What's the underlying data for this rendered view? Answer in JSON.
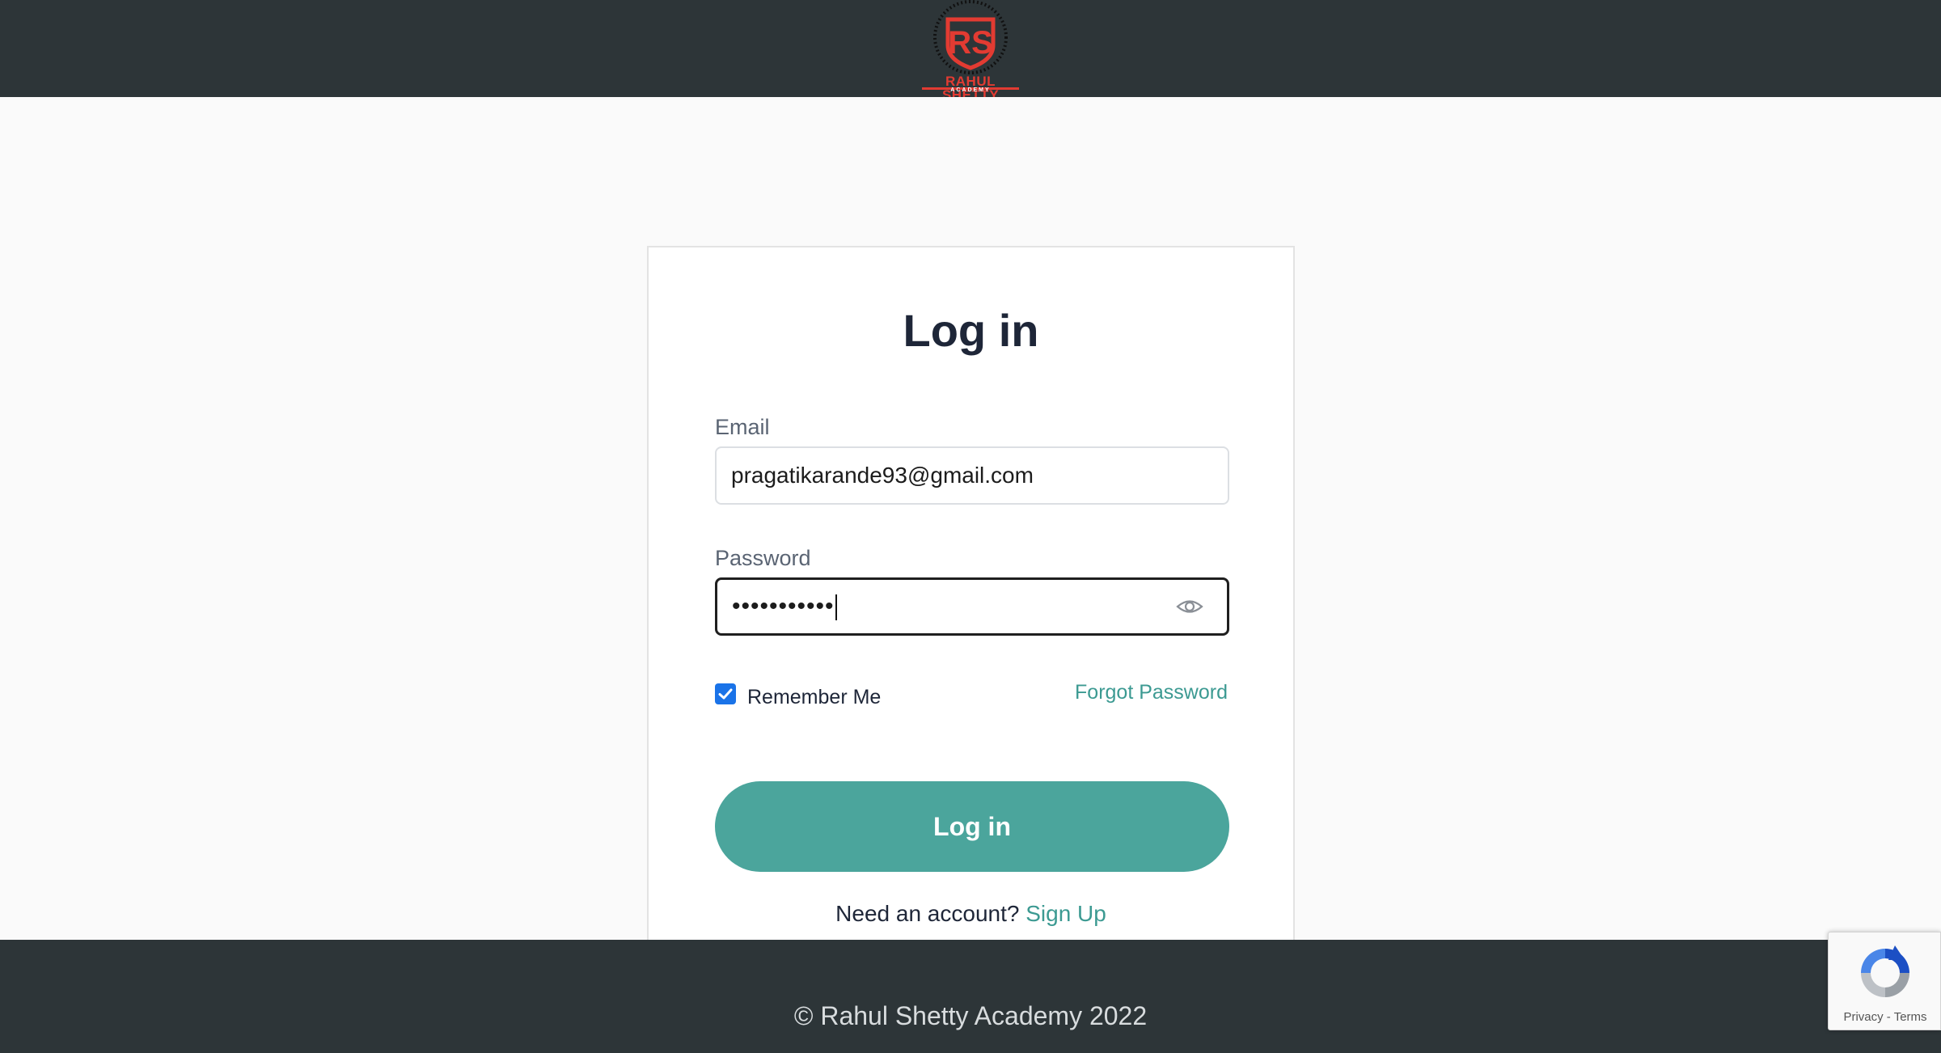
{
  "header": {
    "logo_text": "RAHUL SHETTY",
    "logo_subtext": "ACADEMY"
  },
  "login": {
    "title": "Log in",
    "email_label": "Email",
    "email_value": "pragatikarande93@gmail.com",
    "password_label": "Password",
    "password_masked": "•••••••••••",
    "remember_label": "Remember Me",
    "remember_checked": true,
    "forgot_label": "Forgot Password",
    "submit_label": "Log in",
    "signup_prompt": "Need an account?",
    "signup_link": "Sign Up"
  },
  "footer": {
    "copyright": "© Rahul Shetty Academy 2022"
  },
  "recaptcha": {
    "privacy": "Privacy",
    "separator": "-",
    "terms": "Terms"
  },
  "colors": {
    "header_bg": "#2d3538",
    "accent": "#4ba59c",
    "link": "#3c9a92",
    "brand_red": "#e23b32",
    "checkbox": "#1a73e8"
  },
  "icons": {
    "password_toggle": "eye-icon",
    "checkbox": "checkmark-icon",
    "captcha": "recaptcha-icon"
  }
}
